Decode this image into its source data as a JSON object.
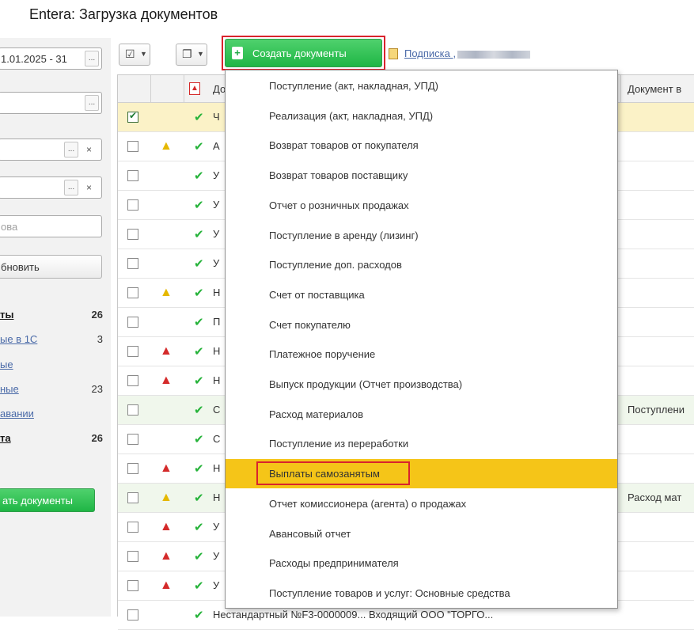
{
  "window": {
    "title": "Entera: Загрузка документов"
  },
  "filters": {
    "period": "1.01.2025 - 31",
    "period_btn": "...",
    "field2_btn": "...",
    "field3_btn": "...",
    "field4_btn": "...",
    "clear": "×",
    "search_placeholder": "ова",
    "refresh_label": "бновить"
  },
  "status_links": [
    {
      "label": "ты",
      "count": "26",
      "bold": true
    },
    {
      "label": "ые в 1С",
      "count": "3",
      "bold": false
    },
    {
      "label": "ые",
      "count": "",
      "bold": false
    },
    {
      "label": "ные",
      "count": "23",
      "bold": false
    },
    {
      "label": "авании",
      "count": "",
      "bold": false
    },
    {
      "label": "та",
      "count": "26",
      "bold": true
    }
  ],
  "left_create_label": "ать документы",
  "toolbar": {
    "create_label": "Создать документы",
    "subscription_label": "Подписка ,"
  },
  "table": {
    "header_doc": "До",
    "header_right": "Документ в",
    "rows": [
      {
        "checked": true,
        "warn": "",
        "text": "Ч",
        "right": "",
        "style": "sel"
      },
      {
        "checked": false,
        "warn": "yellow",
        "text": "А",
        "right": "",
        "style": ""
      },
      {
        "checked": false,
        "warn": "",
        "text": "У",
        "right": "",
        "style": ""
      },
      {
        "checked": false,
        "warn": "",
        "text": "У",
        "right": "",
        "style": ""
      },
      {
        "checked": false,
        "warn": "",
        "text": "У",
        "right": "",
        "style": ""
      },
      {
        "checked": false,
        "warn": "",
        "text": "У",
        "right": "",
        "style": ""
      },
      {
        "checked": false,
        "warn": "yellow",
        "text": "Н",
        "right": "",
        "style": ""
      },
      {
        "checked": false,
        "warn": "",
        "text": "П",
        "right": "",
        "style": ""
      },
      {
        "checked": false,
        "warn": "red",
        "text": "Н",
        "right": "",
        "style": ""
      },
      {
        "checked": false,
        "warn": "red",
        "text": "Н",
        "right": "",
        "style": ""
      },
      {
        "checked": false,
        "warn": "",
        "text": "С",
        "right": "Поступлени",
        "style": "alt"
      },
      {
        "checked": false,
        "warn": "",
        "text": "С",
        "right": "",
        "style": ""
      },
      {
        "checked": false,
        "warn": "red",
        "text": "Н",
        "right": "",
        "style": ""
      },
      {
        "checked": false,
        "warn": "yellow",
        "text": "Н",
        "right": "Расход мат",
        "style": "alt"
      },
      {
        "checked": false,
        "warn": "red",
        "text": "У",
        "right": "",
        "style": ""
      },
      {
        "checked": false,
        "warn": "red",
        "text": "У",
        "right": "",
        "style": ""
      },
      {
        "checked": false,
        "warn": "red",
        "text": "У",
        "right": "",
        "style": ""
      },
      {
        "checked": false,
        "warn": "",
        "text": "Нестандартный №F3-0000009...    Входящий     ООО \"ТОРГО...",
        "right": "",
        "style": ""
      }
    ]
  },
  "menu": {
    "items": [
      "Поступление (акт, накладная, УПД)",
      "Реализация (акт, накладная, УПД)",
      "Возврат товаров от покупателя",
      "Возврат товаров поставщику",
      "Отчет о розничных продажах",
      "Поступление в аренду (лизинг)",
      "Поступление доп. расходов",
      "Счет от поставщика",
      "Счет покупателю",
      "Платежное поручение",
      "Выпуск продукции (Отчет производства)",
      "Расход материалов",
      "Поступление из переработки",
      "Выплаты самозанятым",
      "Отчет комиссионера (агента) о продажах",
      "Авансовый отчет",
      "Расходы предпринимателя",
      "Поступление товаров и услуг: Основные средства"
    ],
    "highlighted_index": 13
  },
  "colors": {
    "accent_green": "#1fb645",
    "highlight_yellow": "#f5c518",
    "frame_red": "#d9232d"
  }
}
